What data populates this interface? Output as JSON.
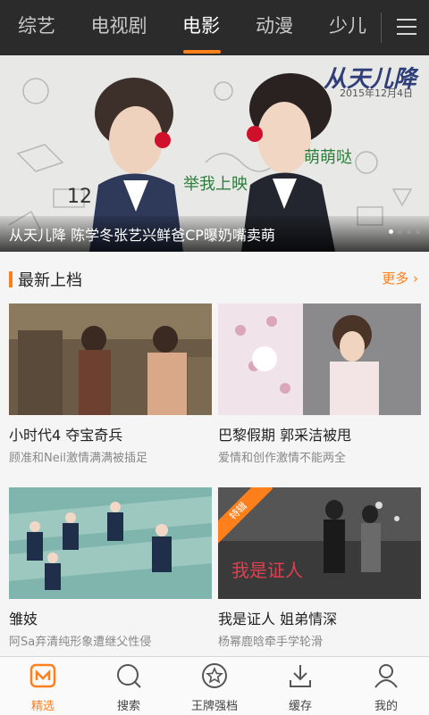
{
  "tabs": [
    "综艺",
    "电视剧",
    "电影",
    "动漫",
    "少儿"
  ],
  "active_tab": "电影",
  "banner": {
    "caption": "从天儿降 陈学冬张艺兴鲜爸CP曝奶嘴卖萌",
    "logo": "从天儿降",
    "date": "2015年12月4日",
    "slides": 4,
    "active_slide": 0
  },
  "section": {
    "title": "最新上档",
    "more": "更多"
  },
  "cards": [
    {
      "title": "小时代4 夺宝奇兵",
      "subtitle": "顾准和Neil激情满满被插足",
      "badge": ""
    },
    {
      "title": "巴黎假期 郭采洁被甩",
      "subtitle": "爱情和创作激情不能两全",
      "badge": ""
    },
    {
      "title": "雏妓",
      "subtitle": "阿Sa弃清纯形象遭继父性侵",
      "badge": ""
    },
    {
      "title": "我是证人 姐弟情深",
      "subtitle": "杨幂鹿晗牵手学轮滑",
      "badge": "特辑"
    }
  ],
  "nav": {
    "items": [
      {
        "label": "精选",
        "icon": "featured-icon"
      },
      {
        "label": "搜索",
        "icon": "search-icon"
      },
      {
        "label": "王牌强档",
        "icon": "star-icon"
      },
      {
        "label": "缓存",
        "icon": "download-icon"
      },
      {
        "label": "我的",
        "icon": "user-icon"
      }
    ],
    "active": "精选"
  },
  "colors": {
    "accent": "#ff7f1a",
    "topbar": "#2b2b2b"
  }
}
